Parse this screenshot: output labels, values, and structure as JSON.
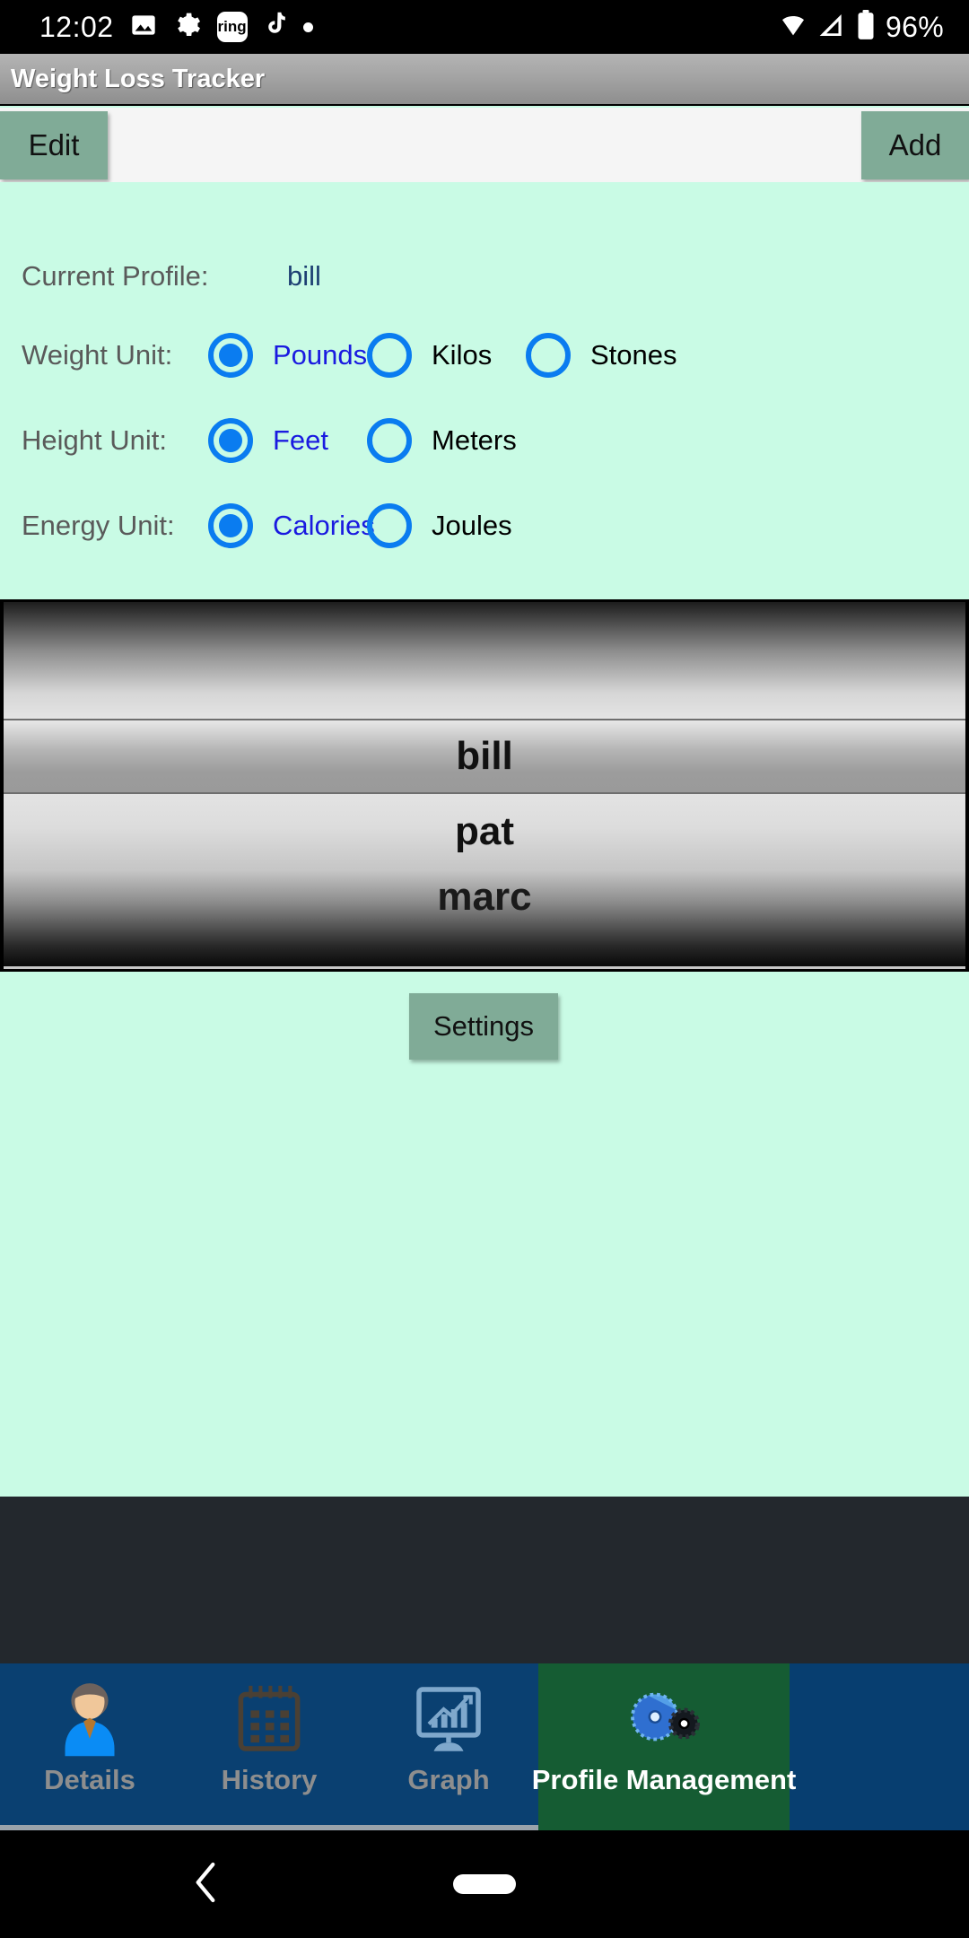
{
  "status_bar": {
    "time": "12:02",
    "battery_percent": "96%",
    "icons": [
      "image-icon",
      "gear-icon",
      "ring-app-icon",
      "tiktok-icon",
      "dot-icon"
    ],
    "right_icons": [
      "wifi-icon",
      "cellular-signal-icon",
      "battery-icon"
    ],
    "ring_badge_text": "ring"
  },
  "app": {
    "title": "Weight Loss Tracker"
  },
  "toolbar": {
    "edit_label": "Edit",
    "add_label": "Add"
  },
  "settings_panel": {
    "profile_row_label": "Current Profile:",
    "current_profile": "bill",
    "weight_row_label": "Weight Unit:",
    "weight_options": [
      {
        "label": "Pounds",
        "selected": true
      },
      {
        "label": "Kilos",
        "selected": false
      },
      {
        "label": "Stones",
        "selected": false
      }
    ],
    "height_row_label": "Height Unit:",
    "height_options": [
      {
        "label": "Feet",
        "selected": true
      },
      {
        "label": "Meters",
        "selected": false
      }
    ],
    "energy_row_label": "Energy Unit:",
    "energy_options": [
      {
        "label": "Calories",
        "selected": true
      },
      {
        "label": "Joules",
        "selected": false
      }
    ]
  },
  "profile_spinner": {
    "blank_item": "",
    "items": [
      {
        "name": "bill",
        "selected": true
      },
      {
        "name": "pat",
        "selected": false
      },
      {
        "name": "marc",
        "selected": false
      }
    ]
  },
  "settings_button": {
    "label": "Settings"
  },
  "tabs": [
    {
      "label": "Details",
      "icon": "person-avatar-icon",
      "active": false
    },
    {
      "label": "History",
      "icon": "calendar-icon",
      "active": false
    },
    {
      "label": "Graph",
      "icon": "monitor-chart-icon",
      "active": false
    },
    {
      "label": "Profile Management",
      "icon": "gears-icon",
      "active": true
    }
  ],
  "nav_bar": {
    "back_label": "back-chevron-icon",
    "home_label": "home-pill-icon"
  },
  "colors": {
    "accent_green": "#80ab97",
    "panel_bg": "#c9fbe5",
    "radio_blue": "#0a7cf0",
    "selected_label_blue": "#1a1ae0",
    "tab_bg": "#0a4071",
    "tab_active_bg": "#155c33",
    "title_bar_gray": "#a4a4a4"
  }
}
